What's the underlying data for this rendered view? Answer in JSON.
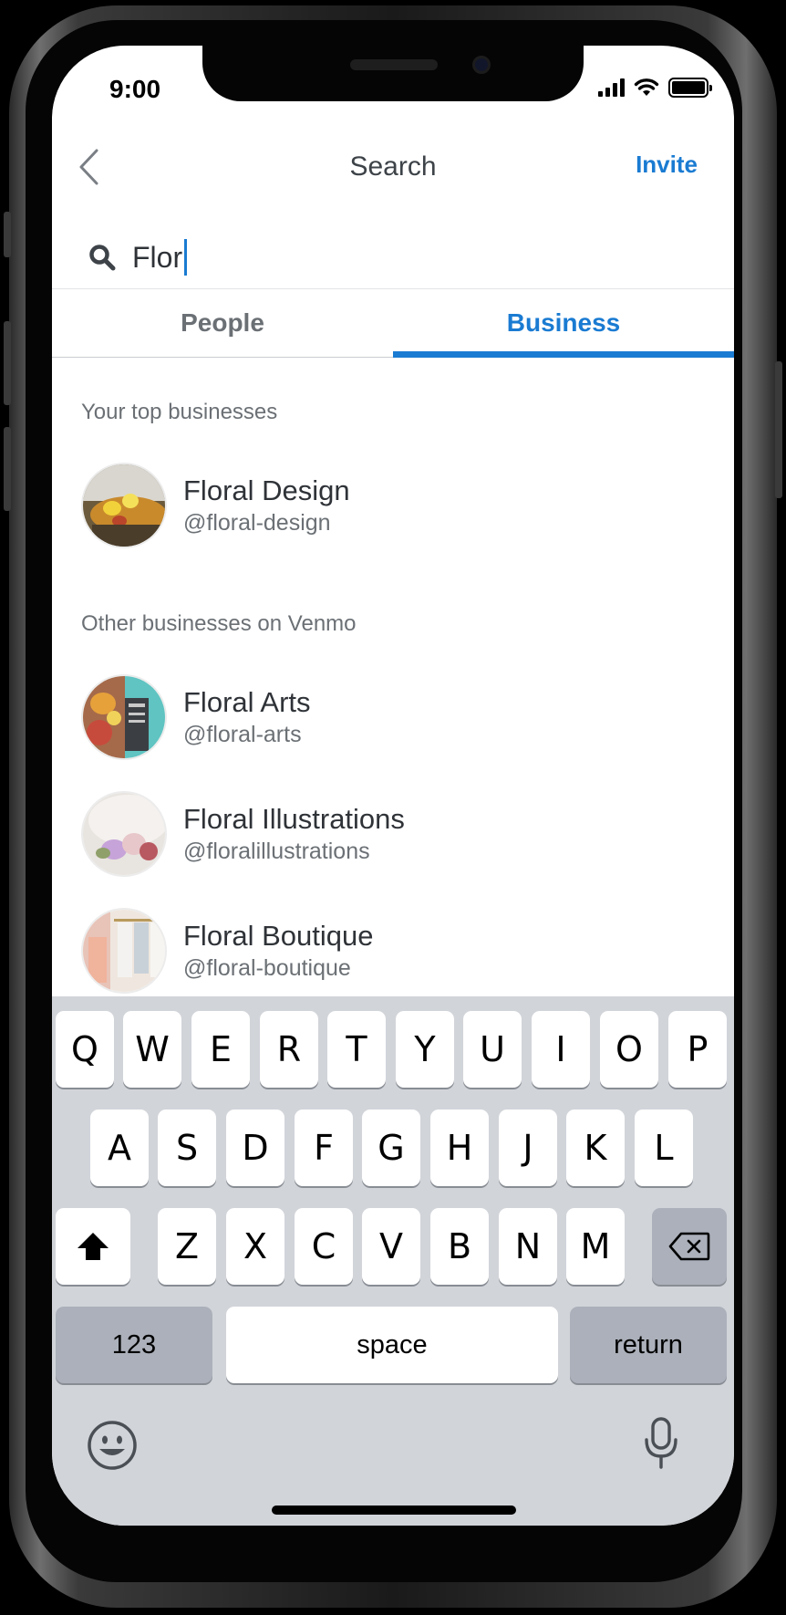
{
  "status": {
    "time": "9:00"
  },
  "nav": {
    "title": "Search",
    "invite_label": "Invite"
  },
  "search": {
    "query": "Flor"
  },
  "tabs": [
    {
      "label": "People",
      "active": false
    },
    {
      "label": "Business",
      "active": true
    }
  ],
  "sections": {
    "top": {
      "label": "Your top businesses",
      "items": [
        {
          "name": "Floral Design",
          "handle": "@floral-design"
        }
      ]
    },
    "other": {
      "label": "Other businesses on Venmo",
      "items": [
        {
          "name": "Floral Arts",
          "handle": "@floral-arts"
        },
        {
          "name": "Floral Illustrations",
          "handle": "@floralillustrations"
        },
        {
          "name": "Floral Boutique",
          "handle": "@floral-boutique"
        }
      ]
    }
  },
  "keyboard": {
    "row1": [
      "Q",
      "W",
      "E",
      "R",
      "T",
      "Y",
      "U",
      "I",
      "O",
      "P"
    ],
    "row2": [
      "A",
      "S",
      "D",
      "F",
      "G",
      "H",
      "J",
      "K",
      "L"
    ],
    "row3": [
      "Z",
      "X",
      "C",
      "V",
      "B",
      "N",
      "M"
    ],
    "numbers_label": "123",
    "space_label": "space",
    "return_label": "return"
  },
  "colors": {
    "accent": "#1a7bd2",
    "text": "#2f3338",
    "muted": "#6b7075",
    "keyboard_bg": "#d1d4d9"
  }
}
